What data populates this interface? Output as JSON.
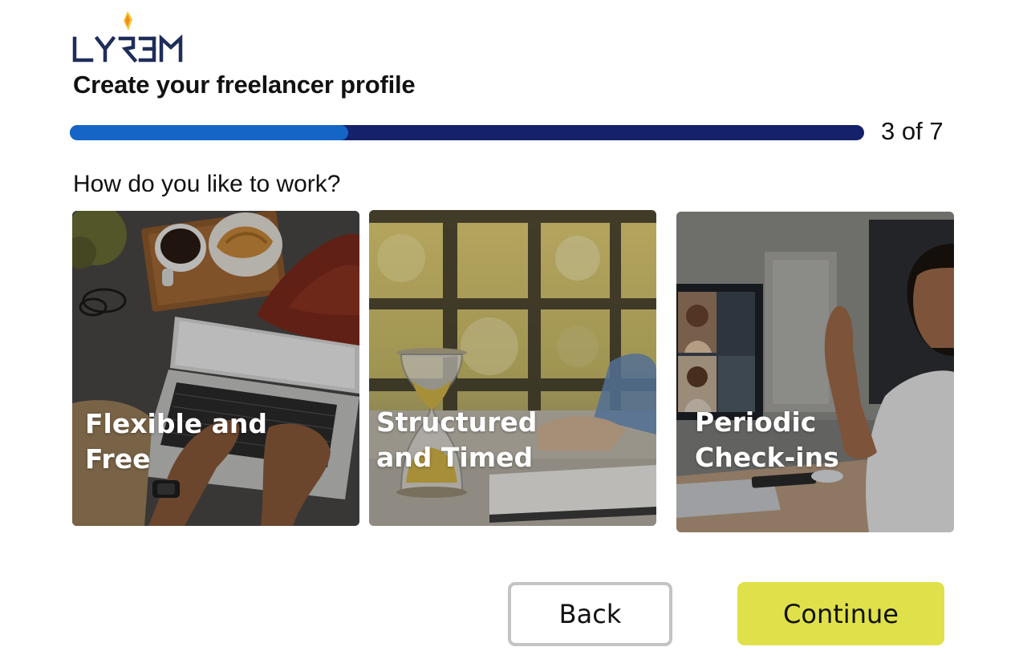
{
  "brand": {
    "logo_text": "LYRJEM",
    "colors": {
      "logo_navy": "#1f2d5a",
      "logo_gem_orange": "#f08a24",
      "logo_gem_yellow": "#f5c631"
    }
  },
  "header": {
    "title": "Create your freelancer profile"
  },
  "progress": {
    "current_step": 3,
    "total_steps": 7,
    "fraction": 0.35,
    "label": "3 of 7",
    "colors": {
      "track": "#15216b",
      "fill": "#1565c7"
    }
  },
  "question": {
    "text": "How do you like to work?"
  },
  "options": [
    {
      "id": "flexible",
      "line1": "Flexible and",
      "line2": "Free",
      "image": "laptop-coffee-photo"
    },
    {
      "id": "structured",
      "line1": "Structured",
      "line2": "and Timed",
      "image": "hourglass-photo"
    },
    {
      "id": "periodic",
      "line1": "Periodic",
      "line2": "Check-ins",
      "image": "video-call-photo"
    }
  ],
  "actions": {
    "back_label": "Back",
    "continue_label": "Continue",
    "continue_color": "#e0e04a"
  }
}
